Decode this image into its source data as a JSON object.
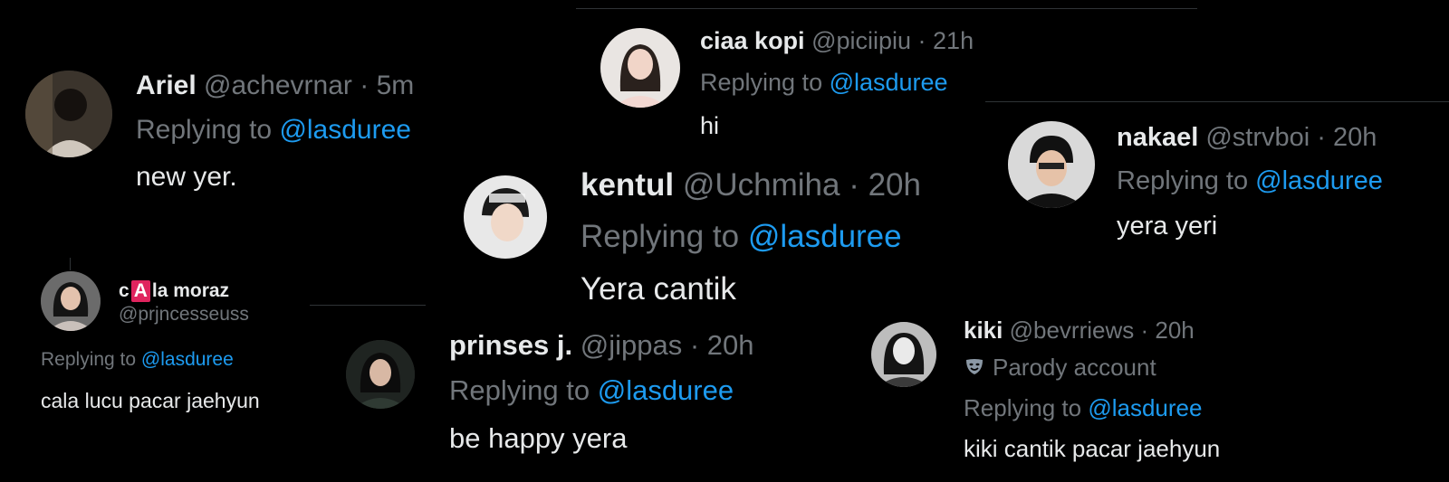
{
  "replies": [
    {
      "id": "ariel",
      "name": "Ariel",
      "handle": "@achevrnar",
      "time": "· 5m",
      "replying_prefix": "Replying to ",
      "replying_to": "@lasduree",
      "text": "new yer."
    },
    {
      "id": "ciaa",
      "name": "ciaa kopi",
      "handle": "@piciipiu",
      "time": "· 21h",
      "replying_prefix": "Replying to ",
      "replying_to": "@lasduree",
      "text": "hi"
    },
    {
      "id": "nakael",
      "name": "nakael",
      "handle": "@strvboi",
      "time": "· 20h",
      "replying_prefix": "Replying to ",
      "replying_to": "@lasduree",
      "text": "yera yeri"
    },
    {
      "id": "kentul",
      "name": "kentul",
      "handle": "@Uchmiha",
      "time": "· 20h",
      "replying_prefix": "Replying to ",
      "replying_to": "@lasduree",
      "text": "Yera cantik"
    },
    {
      "id": "cala",
      "name_prefix": "c",
      "name_badge": "A",
      "name_suffix": "la moraz",
      "handle": "@prjncesseuss",
      "replying_prefix": "Replying to ",
      "replying_to": "@lasduree",
      "text": "cala lucu pacar jaehyun"
    },
    {
      "id": "prinses",
      "name": "prinses j.",
      "handle": "@jippas",
      "time": "· 20h",
      "replying_prefix": "Replying to ",
      "replying_to": "@lasduree",
      "text": "be happy yera"
    },
    {
      "id": "kiki",
      "name": "kiki",
      "handle": "@bevrriews",
      "time": "· 20h",
      "parody_label": "Parody account",
      "replying_prefix": "Replying to ",
      "replying_to": "@lasduree",
      "text": "kiki cantik pacar jaehyun"
    }
  ],
  "icons": {
    "parody": "theater-mask-icon"
  },
  "colors": {
    "background": "#000000",
    "text": "#e7e9ea",
    "muted": "#71767b",
    "link": "#1d9bf0",
    "divider": "#2f3336",
    "badge": "#e0245e"
  }
}
